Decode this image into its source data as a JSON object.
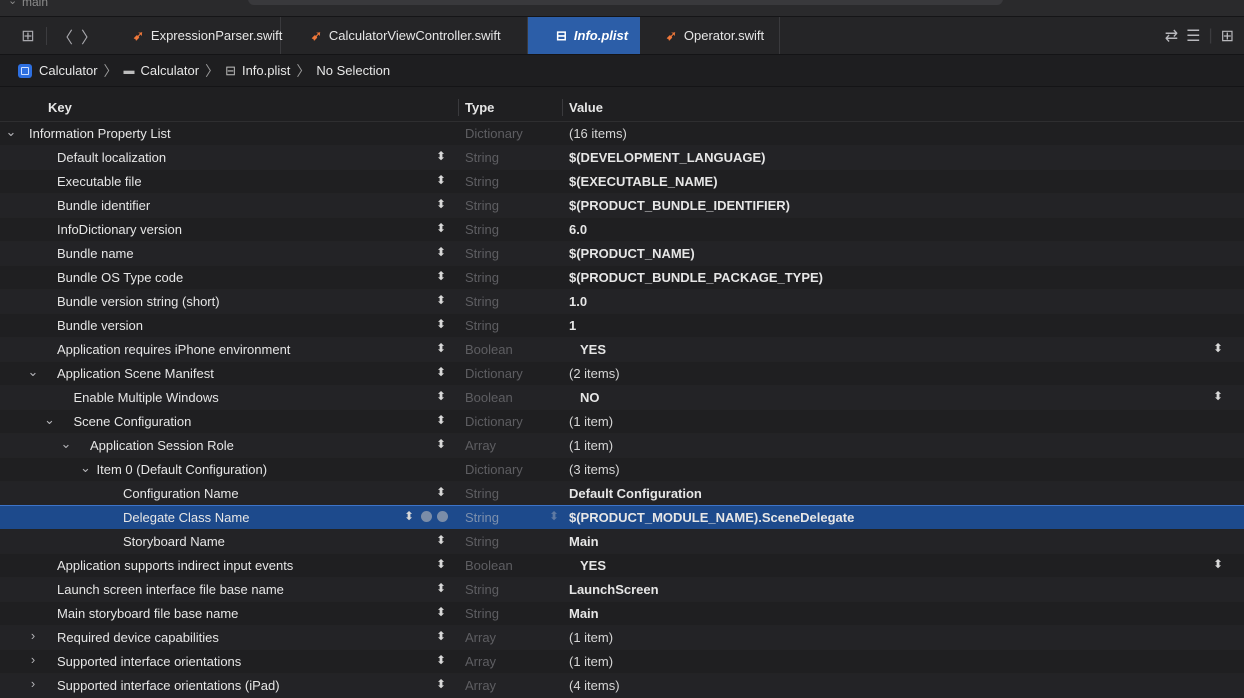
{
  "window": {
    "scheme_fragment": "main"
  },
  "tabs": [
    {
      "label": "ExpressionParser.swift",
      "icon": "swift-file-icon",
      "active": false
    },
    {
      "label": "CalculatorViewController.swift",
      "icon": "swift-file-icon",
      "active": false
    },
    {
      "label": "Info.plist",
      "icon": "plist-file-icon",
      "active": true
    },
    {
      "label": "Operator.swift",
      "icon": "swift-file-icon",
      "active": false
    }
  ],
  "jumpbar": {
    "project": "Calculator",
    "group": "Calculator",
    "file": "Info.plist",
    "selection": "No Selection"
  },
  "columns": {
    "key": "Key",
    "type": "Type",
    "value": "Value"
  },
  "rows": [
    {
      "key": "Information Property List",
      "type": "Dictionary",
      "value": "(16 items)",
      "indent": 0,
      "disclosure": "expanded",
      "stepper": false
    },
    {
      "key": "Default localization",
      "type": "String",
      "value": "$(DEVELOPMENT_LANGUAGE)",
      "indent": 1,
      "disclosure": "none",
      "stepper": true
    },
    {
      "key": "Executable file",
      "type": "String",
      "value": "$(EXECUTABLE_NAME)",
      "indent": 1,
      "disclosure": "none",
      "stepper": true
    },
    {
      "key": "Bundle identifier",
      "type": "String",
      "value": "$(PRODUCT_BUNDLE_IDENTIFIER)",
      "indent": 1,
      "disclosure": "none",
      "stepper": true
    },
    {
      "key": "InfoDictionary version",
      "type": "String",
      "value": "6.0",
      "indent": 1,
      "disclosure": "none",
      "stepper": true
    },
    {
      "key": "Bundle name",
      "type": "String",
      "value": "$(PRODUCT_NAME)",
      "indent": 1,
      "disclosure": "none",
      "stepper": true
    },
    {
      "key": "Bundle OS Type code",
      "type": "String",
      "value": "$(PRODUCT_BUNDLE_PACKAGE_TYPE)",
      "indent": 1,
      "disclosure": "none",
      "stepper": true
    },
    {
      "key": "Bundle version string (short)",
      "type": "String",
      "value": "1.0",
      "indent": 1,
      "disclosure": "none",
      "stepper": true
    },
    {
      "key": "Bundle version",
      "type": "String",
      "value": "1",
      "indent": 1,
      "disclosure": "none",
      "stepper": true
    },
    {
      "key": "Application requires iPhone environment",
      "type": "Boolean",
      "value": "YES",
      "indent": 1,
      "disclosure": "none",
      "stepper": true,
      "bool": true
    },
    {
      "key": "Application Scene Manifest",
      "type": "Dictionary",
      "value": "(2 items)",
      "indent": 1,
      "disclosure": "expanded",
      "stepper": true
    },
    {
      "key": "Enable Multiple Windows",
      "type": "Boolean",
      "value": "NO",
      "indent": 2,
      "disclosure": "none",
      "stepper": true,
      "bool": true
    },
    {
      "key": "Scene Configuration",
      "type": "Dictionary",
      "value": "(1 item)",
      "indent": 2,
      "disclosure": "expanded",
      "stepper": true
    },
    {
      "key": "Application Session Role",
      "type": "Array",
      "value": "(1 item)",
      "indent": 3,
      "disclosure": "expanded",
      "stepper": true
    },
    {
      "key": "Item 0 (Default Configuration)",
      "type": "Dictionary",
      "value": "(3 items)",
      "indent": 4,
      "disclosure": "expanded",
      "stepper": false
    },
    {
      "key": "Configuration Name",
      "type": "String",
      "value": "Default Configuration",
      "indent": 5,
      "disclosure": "none",
      "stepper": true
    },
    {
      "key": "Delegate Class Name",
      "type": "String",
      "value": "$(PRODUCT_MODULE_NAME).SceneDelegate",
      "indent": 5,
      "disclosure": "none",
      "stepper": true,
      "selected": true
    },
    {
      "key": "Storyboard Name",
      "type": "String",
      "value": "Main",
      "indent": 5,
      "disclosure": "none",
      "stepper": true
    },
    {
      "key": "Application supports indirect input events",
      "type": "Boolean",
      "value": "YES",
      "indent": 1,
      "disclosure": "none",
      "stepper": true,
      "bool": true
    },
    {
      "key": "Launch screen interface file base name",
      "type": "String",
      "value": "LaunchScreen",
      "indent": 1,
      "disclosure": "none",
      "stepper": true
    },
    {
      "key": "Main storyboard file base name",
      "type": "String",
      "value": "Main",
      "indent": 1,
      "disclosure": "none",
      "stepper": true
    },
    {
      "key": "Required device capabilities",
      "type": "Array",
      "value": "(1 item)",
      "indent": 1,
      "disclosure": "collapsed",
      "stepper": true
    },
    {
      "key": "Supported interface orientations",
      "type": "Array",
      "value": "(1 item)",
      "indent": 1,
      "disclosure": "collapsed",
      "stepper": true
    },
    {
      "key": "Supported interface orientations (iPad)",
      "type": "Array",
      "value": "(4 items)",
      "indent": 1,
      "disclosure": "collapsed",
      "stepper": true
    }
  ]
}
